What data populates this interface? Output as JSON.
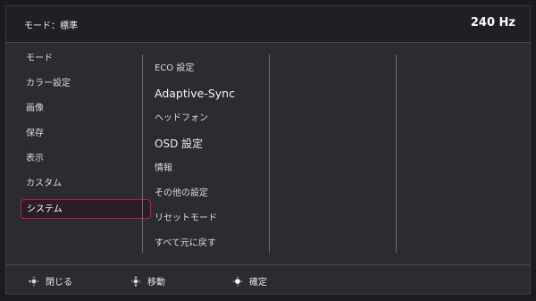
{
  "header": {
    "mode_title": "モード：標準",
    "refresh_rate": "240 Hz"
  },
  "menu": {
    "items": [
      {
        "label": "モード"
      },
      {
        "label": "カラー設定"
      },
      {
        "label": "画像"
      },
      {
        "label": "保存"
      },
      {
        "label": "表示"
      },
      {
        "label": "カスタム"
      },
      {
        "label": "システム"
      }
    ],
    "selected": "システム"
  },
  "submenu": {
    "items": [
      {
        "label": "ECO 設定"
      },
      {
        "label": "Adaptive-Sync"
      },
      {
        "label": "ヘッドフォン"
      },
      {
        "label": "OSD 設定"
      },
      {
        "label": "情報"
      },
      {
        "label": "その他の設定"
      },
      {
        "label": "リセットモード"
      },
      {
        "label": "すべて元に戻す"
      }
    ]
  },
  "footer": {
    "close_label": "閉じる",
    "move_label": "移動",
    "confirm_label": "確定"
  },
  "colors": {
    "accent": "#c2185b",
    "panel": "#2a2c31",
    "topbar": "#1f2024"
  },
  "icons": {
    "close": "joystick-left-icon",
    "move": "joystick-updown-icon",
    "confirm": "joystick-press-icon"
  }
}
